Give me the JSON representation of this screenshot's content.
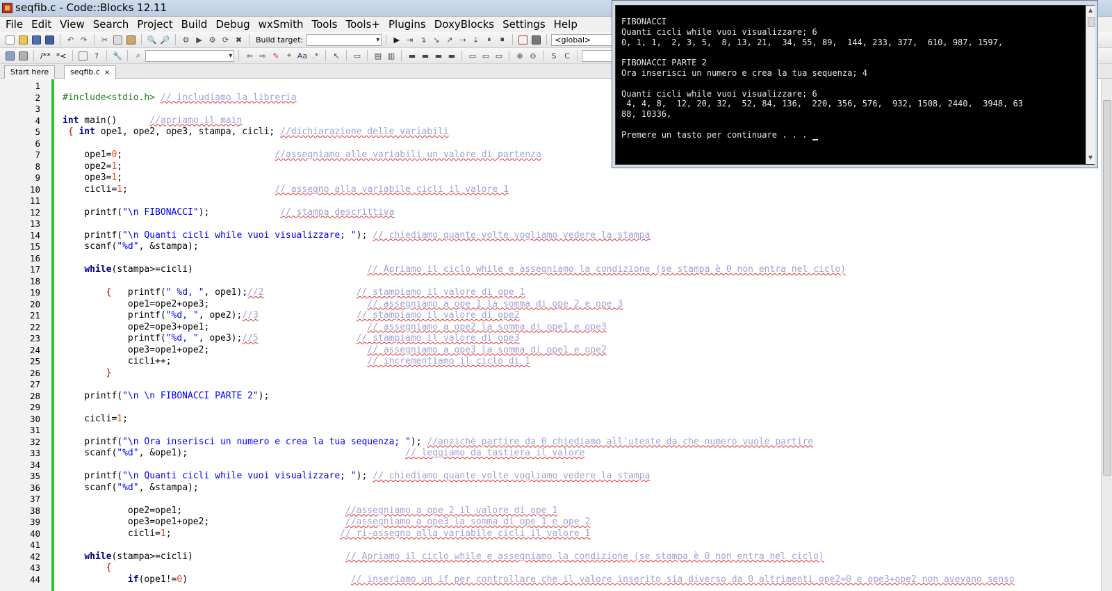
{
  "window": {
    "title": "seqfib.c - Code::Blocks 12.11"
  },
  "menu": [
    "File",
    "Edit",
    "View",
    "Search",
    "Project",
    "Build",
    "Debug",
    "wxSmith",
    "Tools",
    "Tools+",
    "Plugins",
    "DoxyBlocks",
    "Settings",
    "Help"
  ],
  "toolbar": {
    "build_target_label": "Build target:",
    "build_target_value": "",
    "scope_value": "<global>",
    "search_value": "",
    "doxy_comment_label": "/**",
    "doxy_inline_label": "*<"
  },
  "tabs": [
    {
      "label": "Start here"
    },
    {
      "label": "seqfib.c",
      "close": "×"
    }
  ],
  "editor": {
    "lines": [
      {
        "n": "1",
        "code": ""
      },
      {
        "n": "2",
        "code": "<span class=\"pp\">#include&lt;stdio.h&gt;</span> <span class=\"c\">// includiamo la libreria</span>"
      },
      {
        "n": "3",
        "code": ""
      },
      {
        "n": "4",
        "code": "<span class=\"k\">int</span> main()      <span class=\"c\">//apriamo il main</span>"
      },
      {
        "n": "5",
        "code": " <span class=\"o\">{</span> <span class=\"k\">int</span> ope1, ope2, ope3, stampa, cicli; <span class=\"c\">//dichiarazione delle variabili</span>"
      },
      {
        "n": "6",
        "code": ""
      },
      {
        "n": "7",
        "code": "    ope1=<span class=\"n\">0</span>;                            <span class=\"c\">//assegniamo alle variabili un valore di partenza</span>"
      },
      {
        "n": "8",
        "code": "    ope2=<span class=\"n\">1</span>;"
      },
      {
        "n": "9",
        "code": "    ope3=<span class=\"n\">1</span>;"
      },
      {
        "n": "10",
        "code": "    cicli=<span class=\"n\">1</span>;                           <span class=\"c\">// assegno alla variabile cicli il valore 1</span>"
      },
      {
        "n": "11",
        "code": ""
      },
      {
        "n": "12",
        "code": "    printf(<span class=\"s\">\"\\n FIBONACCI\"</span>);             <span class=\"c\">// stampa descrittiva</span>"
      },
      {
        "n": "13",
        "code": ""
      },
      {
        "n": "14",
        "code": "    printf(<span class=\"s\">\"\\n Quanti cicli while vuoi visualizzare; \"</span>); <span class=\"c\">// chiediamo quante volte vogliamo vedere la stampa</span>"
      },
      {
        "n": "15",
        "code": "    scanf(<span class=\"s\">\"%d\"</span>, &amp;stampa);"
      },
      {
        "n": "16",
        "code": ""
      },
      {
        "n": "17",
        "code": "    <span class=\"k\">while</span>(stampa&gt;=cicli)                                <span class=\"c\">// Apriamo il ciclo while e assegniamo la condizione (se stampa è 0 non entra nel ciclo)</span>"
      },
      {
        "n": "18",
        "code": ""
      },
      {
        "n": "19",
        "code": "        <span class=\"o\">{</span>   printf(<span class=\"s\">\" %d, \"</span>, ope1);<span class=\"c\">//2</span>                 <span class=\"c\">// stampiamo il valore di ope 1</span>"
      },
      {
        "n": "20",
        "code": "            ope1=ope2+ope3;                             <span class=\"c\">// assegniamo a ope 1 la somma di ope 2 e ope 3</span>"
      },
      {
        "n": "21",
        "code": "            printf(<span class=\"s\">\"%d, \"</span>, ope2);<span class=\"c\">//3</span>                  <span class=\"c\">// stampiamo il valore di ope2</span>"
      },
      {
        "n": "22",
        "code": "            ope2=ope3+ope1;                             <span class=\"c\">// assegniamo a ope2 la somma di ope1 e ope3</span>"
      },
      {
        "n": "23",
        "code": "            printf(<span class=\"s\">\"%d, \"</span>, ope3);<span class=\"c\">//5</span>                  <span class=\"c\">// stampiamo il valore di ope3</span>"
      },
      {
        "n": "24",
        "code": "            ope3=ope1+ope2;                             <span class=\"c\">// assegniamo a ope3 la somma di ope1 e ope2</span>"
      },
      {
        "n": "25",
        "code": "            cicli++;                                    <span class=\"c\">// incrementiamo il ciclo di 1</span>"
      },
      {
        "n": "26",
        "code": "        <span class=\"o\">}</span>"
      },
      {
        "n": "27",
        "code": ""
      },
      {
        "n": "28",
        "code": "    printf(<span class=\"s\">\"\\n \\n FIBONACCI PARTE 2\"</span>);"
      },
      {
        "n": "29",
        "code": ""
      },
      {
        "n": "30",
        "code": "    cicli=<span class=\"n\">1</span>;"
      },
      {
        "n": "31",
        "code": ""
      },
      {
        "n": "32",
        "code": "    printf(<span class=\"s\">\"\\n Ora inserisci un numero e crea la tua sequenza; \"</span>); <span class=\"c\">//anzichè partire da 0 chiediamo all'utente da che numero vuole partire</span>"
      },
      {
        "n": "33",
        "code": "    scanf(<span class=\"s\">\"%d\"</span>, &amp;ope1);                                        <span class=\"c\">// leggiamo da tastiera il valore</span>"
      },
      {
        "n": "34",
        "code": ""
      },
      {
        "n": "35",
        "code": "    printf(<span class=\"s\">\"\\n Quanti cicli while vuoi visualizzare; \"</span>); <span class=\"c\">// chiediamo quante volte vogliamo vedere la stampa</span>"
      },
      {
        "n": "36",
        "code": "    scanf(<span class=\"s\">\"%d\"</span>, &amp;stampa);"
      },
      {
        "n": "37",
        "code": ""
      },
      {
        "n": "38",
        "code": "            ope2=ope1;                              <span class=\"c\">//assegniamo a ope 2 il valore di ope 1</span>"
      },
      {
        "n": "39",
        "code": "            ope3=ope1+ope2;                         <span class=\"c\">//assegniamo a ope3 la somma di ope 1 e ope 2</span>"
      },
      {
        "n": "40",
        "code": "            cicli=<span class=\"n\">1</span>;                               <span class=\"c\">// ri-assegno alla variabile cicli il valore 1</span>"
      },
      {
        "n": "41",
        "code": ""
      },
      {
        "n": "42",
        "code": "    <span class=\"k\">while</span>(stampa&gt;=cicli)                            <span class=\"c\">// Apriamo il ciclo while e assegniamo la condizione (se stampa è 0 non entra nel ciclo)</span>"
      },
      {
        "n": "43",
        "code": "        <span class=\"o\">{</span>"
      },
      {
        "n": "44",
        "code": "            <span class=\"k\">if</span>(ope1!=<span class=\"n\">0</span>)                              <span class=\"c\">// inseriamo un if per controllare che il valore inserito sia diverso da 0 altrimenti ope2=0 e ope3+ope2 non avevano senso</span>"
      }
    ]
  },
  "console": {
    "lines": [
      "FIBONACCI",
      "Quanti cicli while vuoi visualizzare; 6",
      "0, 1, 1,  2, 3, 5,  8, 13, 21,  34, 55, 89,  144, 233, 377,  610, 987, 1597,",
      "",
      "FIBONACCI PARTE 2",
      "Ora inserisci un numero e crea la tua sequenza; 4",
      "",
      "Quanti cicli while vuoi visualizzare; 6",
      " 4, 4, 8,  12, 20, 32,  52, 84, 136,  220, 356, 576,  932, 1508, 2440,  3948, 63",
      "88, 10336,",
      "",
      "Premere un tasto per continuare . . . "
    ]
  },
  "colors": {
    "changebar": "#29c72f",
    "keyword": "#00008b",
    "string": "#0000ff",
    "comment": "#a0a0d8",
    "number": "#f04020"
  }
}
